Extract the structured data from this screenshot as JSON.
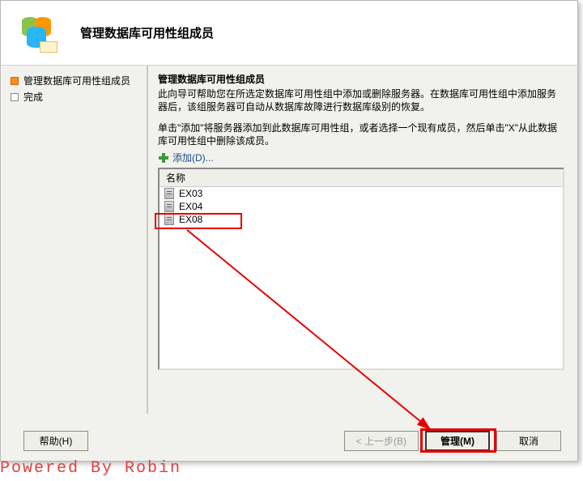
{
  "header": {
    "title": "管理数据库可用性组成员"
  },
  "sidebar": {
    "items": [
      {
        "label": "管理数据库可用性组成员",
        "active": true
      },
      {
        "label": "完成",
        "active": false
      }
    ]
  },
  "content": {
    "title": "管理数据库可用性组成员",
    "desc": "此向导可帮助您在所选定数据库可用性组中添加或删除服务器。在数据库可用性组中添加服务器后，该组服务器可自动从数据库故障进行数据库级别的恢复。",
    "hint": "单击\"添加\"将服务器添加到此数据库可用性组，或者选择一个现有成员，然后单击\"X\"从此数据库可用性组中删除该成员。",
    "add_label": "添加(D)...",
    "column_header": "名称",
    "rows": [
      {
        "name": "EX03"
      },
      {
        "name": "EX04"
      },
      {
        "name": "EX08"
      }
    ]
  },
  "footer": {
    "help": "帮助(H)",
    "back": "< 上一步(B)",
    "manage": "管理(M)",
    "cancel": "取消"
  },
  "watermark": "Powered By Robin",
  "annotations": {
    "highlight_row": "EX08",
    "highlight_button": "manage",
    "arrow_color": "#e60000"
  }
}
